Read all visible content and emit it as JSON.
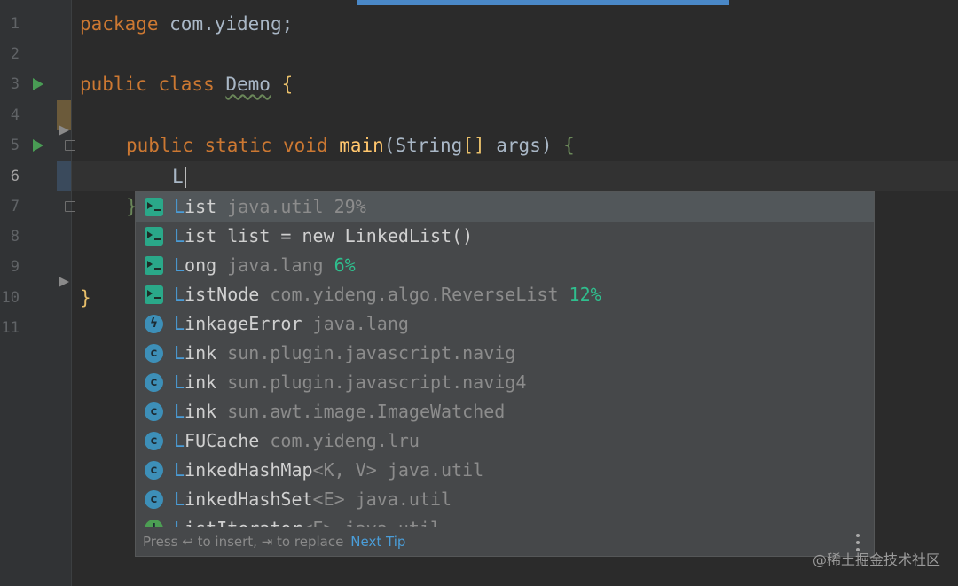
{
  "editor": {
    "line_numbers": [
      "1",
      "2",
      "3",
      "4",
      "5",
      "6",
      "7",
      "8",
      "9",
      "10",
      "11"
    ],
    "code": {
      "l1_kw": "package",
      "l1_rest": " com.yideng;",
      "l3_kw": "public class",
      "l3_name": "Demo",
      "l3_brace": "{",
      "l5_kw": "public static void",
      "l5_fn": "main",
      "l5_paren_open": "(",
      "l5_type": "String",
      "l5_brackets": "[]",
      "l5_args": " args",
      "l5_paren_close": ")",
      "l5_brace": "{",
      "l6_typed": "L",
      "l7_brace": "}",
      "l10_brace": "}"
    }
  },
  "completion": {
    "items": [
      {
        "icon": "template-icon",
        "match": "L",
        "rest": "ist",
        "suffix": "",
        "pkg": " java.util 29%",
        "pct": ""
      },
      {
        "icon": "template-icon",
        "match": "L",
        "rest": "ist list = new LinkedList()",
        "suffix": "",
        "pkg": "",
        "pct": ""
      },
      {
        "icon": "template-icon",
        "match": "L",
        "rest": "ong",
        "suffix": "",
        "pkg": " java.lang",
        "pct": " 6%"
      },
      {
        "icon": "template-icon",
        "match": "L",
        "rest": "istNode",
        "suffix": "",
        "pkg": " com.yideng.algo.ReverseList",
        "pct": " 12%"
      },
      {
        "icon": "exception-class-icon",
        "match": "L",
        "rest": "inkageError",
        "suffix": "",
        "pkg": " java.lang",
        "pct": ""
      },
      {
        "icon": "class-icon",
        "match": "L",
        "rest": "ink",
        "suffix": "",
        "pkg": " sun.plugin.javascript.navig",
        "pct": ""
      },
      {
        "icon": "class-icon",
        "match": "L",
        "rest": "ink",
        "suffix": "",
        "pkg": " sun.plugin.javascript.navig4",
        "pct": ""
      },
      {
        "icon": "class-icon",
        "match": "L",
        "rest": "ink",
        "suffix": "",
        "pkg": " sun.awt.image.ImageWatched",
        "pct": ""
      },
      {
        "icon": "class-icon",
        "match": "L",
        "rest": "FUCache",
        "suffix": "",
        "pkg": " com.yideng.lru",
        "pct": ""
      },
      {
        "icon": "class-icon",
        "match": "L",
        "rest": "inkedHashMap",
        "suffix": "<K, V>",
        "pkg": " java.util",
        "pct": ""
      },
      {
        "icon": "class-icon",
        "match": "L",
        "rest": "inkedHashSet",
        "suffix": "<E>",
        "pkg": " java.util",
        "pct": ""
      },
      {
        "icon": "interface-icon",
        "match": "L",
        "rest": "istIterator",
        "suffix": "<E>",
        "pkg": " java.util",
        "pct": ""
      }
    ],
    "footer": {
      "hint": "Press ↩ to insert, ⇥ to replace",
      "next_tip": "Next Tip"
    }
  },
  "watermark": "@稀土掘金技术社区",
  "colors": {
    "background": "#2b2b2b",
    "popup_bg": "#46484a",
    "selected_row": "#52575a",
    "keyword": "#cc7832",
    "match_highlight": "#4a9dd8",
    "percentage": "#2fbf8e"
  }
}
